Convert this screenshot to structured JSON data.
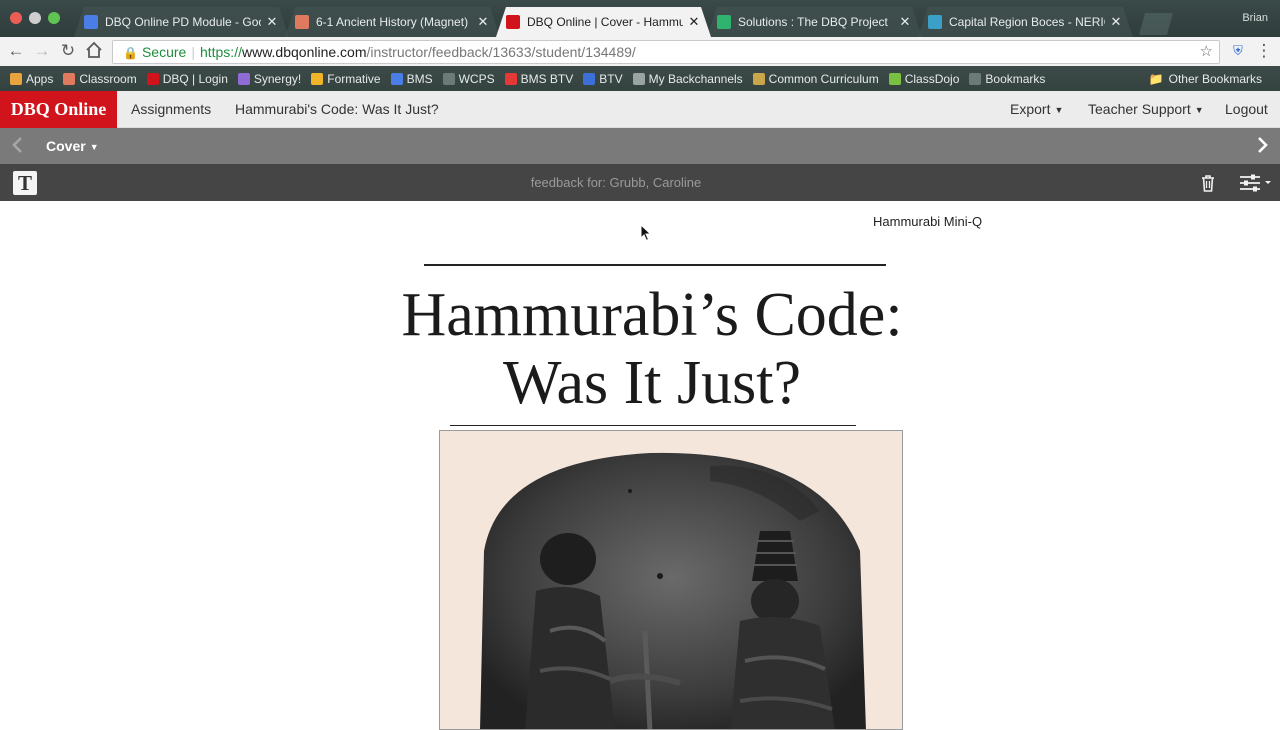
{
  "browser": {
    "profile": "Brian",
    "tabs": [
      {
        "title": "DBQ Online PD Module - Goog",
        "favicon_color": "#4a7ee6",
        "active": false
      },
      {
        "title": "6-1 Ancient History (Magnet)",
        "favicon_color": "#e07a5f",
        "active": false
      },
      {
        "title": "DBQ Online | Cover - Hammur",
        "favicon_color": "#d1141b",
        "active": true
      },
      {
        "title": "Solutions : The DBQ Project",
        "favicon_color": "#2fb36e",
        "active": false
      },
      {
        "title": "Capital Region Boces - NERIC",
        "favicon_color": "#3aa0c8",
        "active": false
      }
    ],
    "address": {
      "secure_label": "Secure",
      "scheme": "https://",
      "host": "www.dbqonline.com",
      "path": "/instructor/feedback/13633/student/134489/"
    },
    "bookmarks": [
      {
        "label": "Apps",
        "color": "#e8a33d"
      },
      {
        "label": "Classroom",
        "color": "#e07a5f"
      },
      {
        "label": "DBQ | Login",
        "color": "#d1141b"
      },
      {
        "label": "Synergy!",
        "color": "#8f6bd6"
      },
      {
        "label": "Formative",
        "color": "#f0b429"
      },
      {
        "label": "BMS",
        "color": "#4a7ee6"
      },
      {
        "label": "WCPS",
        "color": "#6c7a78"
      },
      {
        "label": "BMS BTV",
        "color": "#e53935"
      },
      {
        "label": "BTV",
        "color": "#3d6fd8"
      },
      {
        "label": "My Backchannels",
        "color": "#9aa5a3"
      },
      {
        "label": "Common Curriculum",
        "color": "#c9a64a"
      },
      {
        "label": "ClassDojo",
        "color": "#7ac142"
      },
      {
        "label": "Bookmarks",
        "color": "#6c7a78"
      }
    ],
    "other_bookmarks": "Other Bookmarks"
  },
  "app": {
    "brand": "DBQ Online",
    "nav": {
      "assignments": "Assignments",
      "doc_title": "Hammurabi's Code: Was It Just?",
      "export": "Export",
      "teacher_support": "Teacher Support",
      "logout": "Logout"
    },
    "docbar": {
      "section": "Cover"
    },
    "feedback": {
      "label": "feedback for: Grubb, Caroline",
      "tool_letter": "T"
    }
  },
  "document": {
    "mini_q": "Hammurabi Mini-Q",
    "title_line1": "Hammurabi’s Code:",
    "title_line2": "Was It Just?"
  }
}
